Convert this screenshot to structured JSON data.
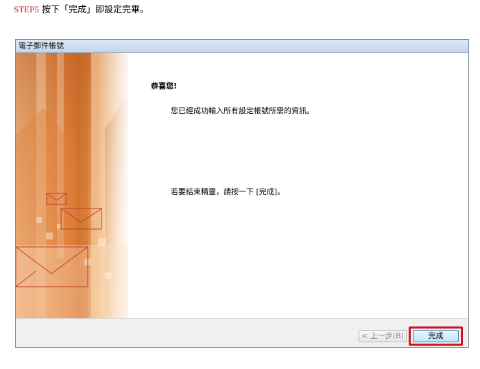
{
  "instruction_caption": {
    "step": "STEP5",
    "text": " 按下「完成」即設定完畢。"
  },
  "window": {
    "title": "電子郵件帳號",
    "heading": "恭喜您!",
    "message": "您已經成功輸入所有設定帳號所需的資訊。",
    "instruction": "若要結束精靈，請按一下 [完成]。",
    "buttons": {
      "back_label": "< 上一步(B)",
      "finish_label": "完成"
    }
  },
  "colors": {
    "step_accent": "#c0282d",
    "highlight_border": "#d0131b",
    "art_orange": "#d9762f"
  }
}
